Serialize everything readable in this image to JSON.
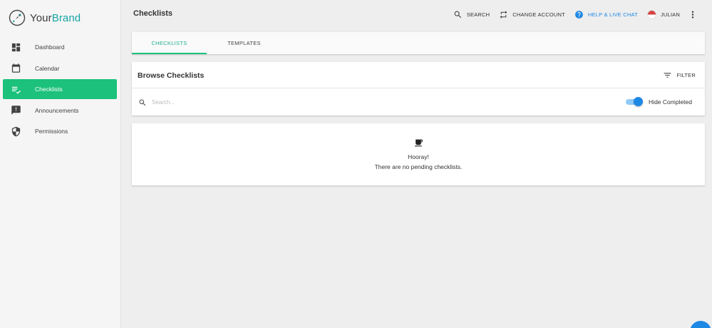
{
  "brand": {
    "name_part1": "Your",
    "name_part2": "Brand",
    "logo_icon": "rocket-icon",
    "accent_color": "#1aa4a4"
  },
  "sidebar": {
    "items": [
      {
        "label": "Dashboard",
        "icon": "dashboard-icon",
        "active": false
      },
      {
        "label": "Calendar",
        "icon": "calendar-icon",
        "active": false
      },
      {
        "label": "Checklists",
        "icon": "checklist-icon",
        "active": true
      },
      {
        "label": "Announcements",
        "icon": "announcement-icon",
        "active": false
      },
      {
        "label": "Permissions",
        "icon": "shield-icon",
        "active": false
      }
    ],
    "active_color": "#1cc17c"
  },
  "header": {
    "title": "Checklists",
    "search_label": "SEARCH",
    "change_account_label": "CHANGE ACCOUNT",
    "help_label": "HELP & LIVE CHAT",
    "user_name": "JULIAN",
    "help_color": "#1e88e5"
  },
  "tabs": [
    {
      "label": "CHECKLISTS",
      "active": true
    },
    {
      "label": "TEMPLATES",
      "active": false
    }
  ],
  "browse": {
    "title": "Browse Checklists",
    "filter_label": "FILTER",
    "search_placeholder": "Search...",
    "search_value": "",
    "hide_completed_label": "Hide Completed",
    "hide_completed_on": true
  },
  "empty_state": {
    "icon": "coffee-icon",
    "title": "Hooray!",
    "message": "There are no pending checklists."
  }
}
